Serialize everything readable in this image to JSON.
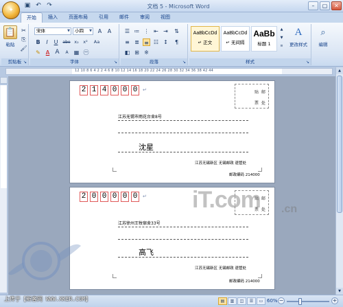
{
  "window": {
    "title": "文档 5 - Microsoft Word"
  },
  "quick_access": {
    "save_icon": "save-icon",
    "undo_icon": "undo-icon",
    "redo_icon": "redo-icon"
  },
  "tabs": [
    {
      "label": "开始",
      "active": true
    },
    {
      "label": "插入"
    },
    {
      "label": "页面布局"
    },
    {
      "label": "引用"
    },
    {
      "label": "邮件"
    },
    {
      "label": "审阅"
    },
    {
      "label": "视图"
    }
  ],
  "ribbon": {
    "clipboard": {
      "paste_label": "粘贴",
      "group_label": "剪贴板"
    },
    "font": {
      "font_name": "宋体",
      "font_size": "小四",
      "group_label": "字体",
      "bold": "B",
      "italic": "I",
      "underline": "U",
      "strike": "abe",
      "subscript": "x₂",
      "superscript": "x²",
      "change_case": "Aa",
      "grow": "A",
      "shrink": "A",
      "clear": "A",
      "phonetic": "A",
      "border": "A"
    },
    "paragraph": {
      "group_label": "段落"
    },
    "styles": {
      "group_label": "样式",
      "items": [
        {
          "sample": "AaBbCcDd",
          "name": "↵ 正文",
          "selected": true
        },
        {
          "sample": "AaBbCcDd",
          "name": "↵ 无间隔"
        },
        {
          "sample": "AaBb",
          "name": "标题 1"
        }
      ],
      "change_styles_label": "更改样式"
    },
    "editing": {
      "label": "编辑"
    }
  },
  "ruler": {
    "ticks": "12 10 8 6 4 2     2 4 6 8 10 12 14 16 18 20 22 24 26 28 30 32 34 36 38   42 44"
  },
  "envelopes": [
    {
      "zip": [
        "2",
        "1",
        "4",
        "0",
        "0",
        "0"
      ],
      "stamp": {
        "top_left": "贴",
        "top_right": "邮",
        "bottom_left": "票",
        "bottom_right": "处"
      },
      "address": "江苏无锡市雨花台舍8号",
      "recipient": "沈星",
      "sender": "江苏无锡新区 无锡邮政 退管处",
      "postcode": "邮政编码 214000"
    },
    {
      "zip": [
        "2",
        "0",
        "0",
        "0",
        "0",
        "0"
      ],
      "stamp": {
        "top_left": "贴",
        "top_right": "邮",
        "bottom_left": "票",
        "bottom_right": "处"
      },
      "address": "江苏徐州王牧宿舍33号",
      "recipient": "高飞",
      "sender": "江苏无锡新区 无锡邮政 退管处",
      "postcode": "邮政编码 214000"
    }
  ],
  "watermark": {
    "text": "iT.com",
    "sub": ".cn"
  },
  "credit": "上传于【新客网 WWW.XKER.COM】",
  "status": {
    "zoom": "60%",
    "zoom_fraction": 0.3
  }
}
